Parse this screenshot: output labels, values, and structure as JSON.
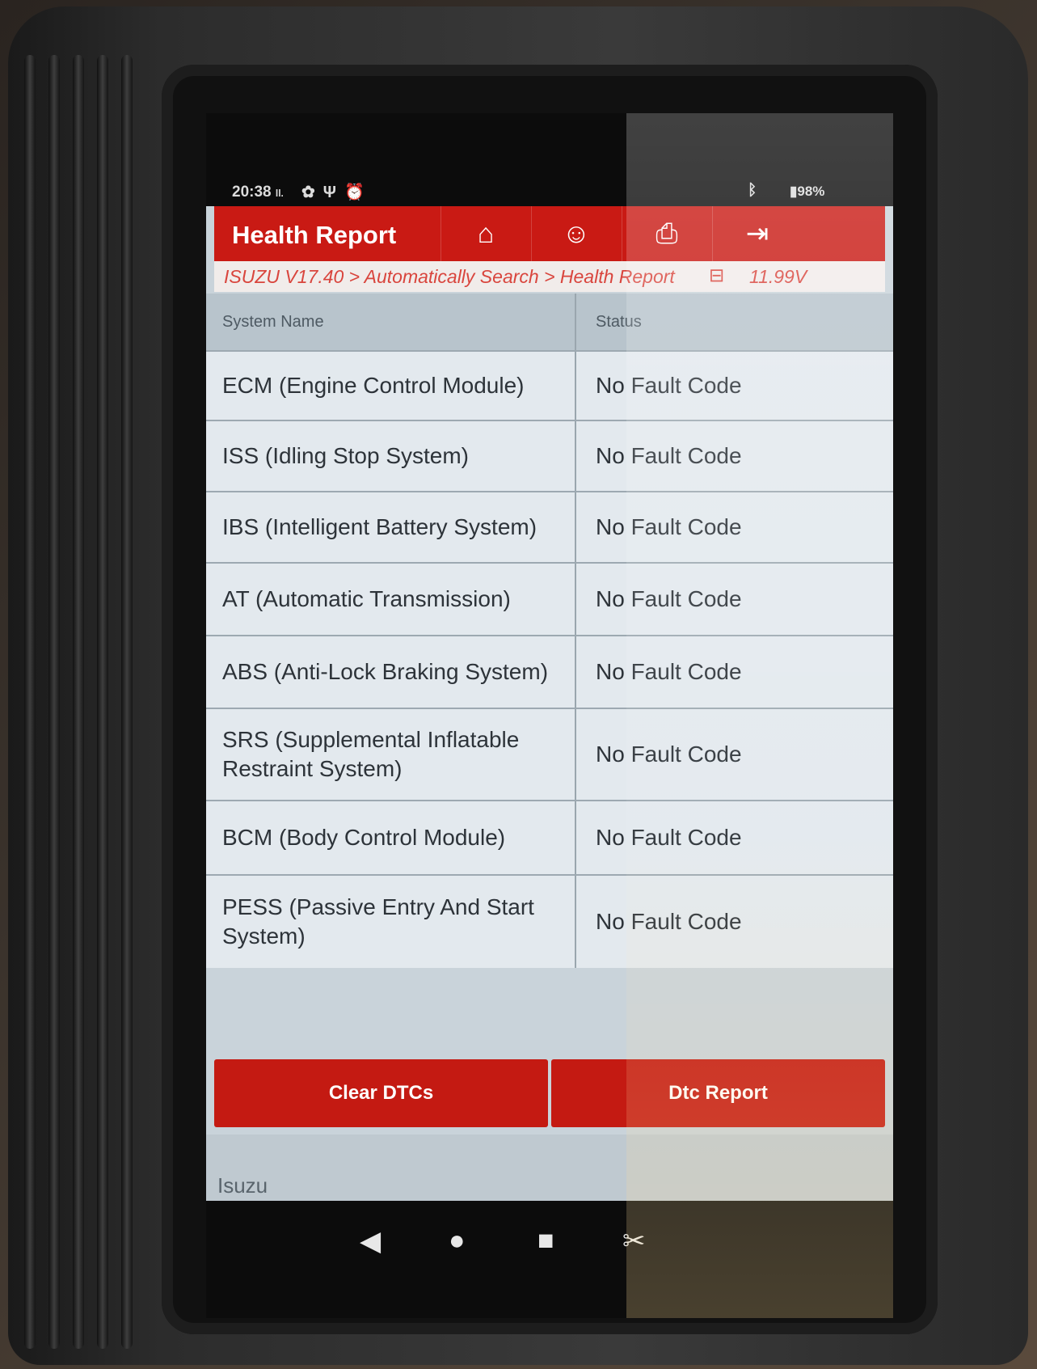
{
  "status_bar": {
    "time": "20:38",
    "signal": "ll.",
    "battery": "98%",
    "icons": [
      "gear-icon",
      "usb-icon",
      "alarm-icon",
      "bluetooth-icon",
      "battery-icon"
    ]
  },
  "header": {
    "title": "Health Report",
    "buttons": [
      "home-icon",
      "user-support-icon",
      "print-icon",
      "exit-icon"
    ],
    "accent_color": "#c91a14"
  },
  "breadcrumb": {
    "path": "ISUZU V17.40 > Automatically Search > Health Report",
    "voltage": "11.99V"
  },
  "table": {
    "headers": [
      "System Name",
      "Status"
    ],
    "rows": [
      {
        "system": "ECM (Engine Control Module)",
        "status": "No Fault Code"
      },
      {
        "system": "ISS (Idling Stop System)",
        "status": "No Fault Code"
      },
      {
        "system": "IBS (Intelligent Battery System)",
        "status": "No Fault Code"
      },
      {
        "system": "AT (Automatic Transmission)",
        "status": "No Fault Code"
      },
      {
        "system": "ABS (Anti-Lock Braking System)",
        "status": "No Fault Code"
      },
      {
        "system": "SRS (Supplemental Inflatable Restraint System)",
        "status": "No Fault Code"
      },
      {
        "system": "BCM (Body Control Module)",
        "status": "No Fault Code"
      },
      {
        "system": "PESS (Passive Entry And Start System)",
        "status": "No Fault Code"
      }
    ]
  },
  "actions": {
    "clear_label": "Clear DTCs",
    "report_label": "Dtc Report"
  },
  "footer": {
    "vehicle": "Isuzu"
  },
  "nav": [
    "back-icon",
    "home-circle-icon",
    "recents-icon",
    "screenshot-icon"
  ]
}
